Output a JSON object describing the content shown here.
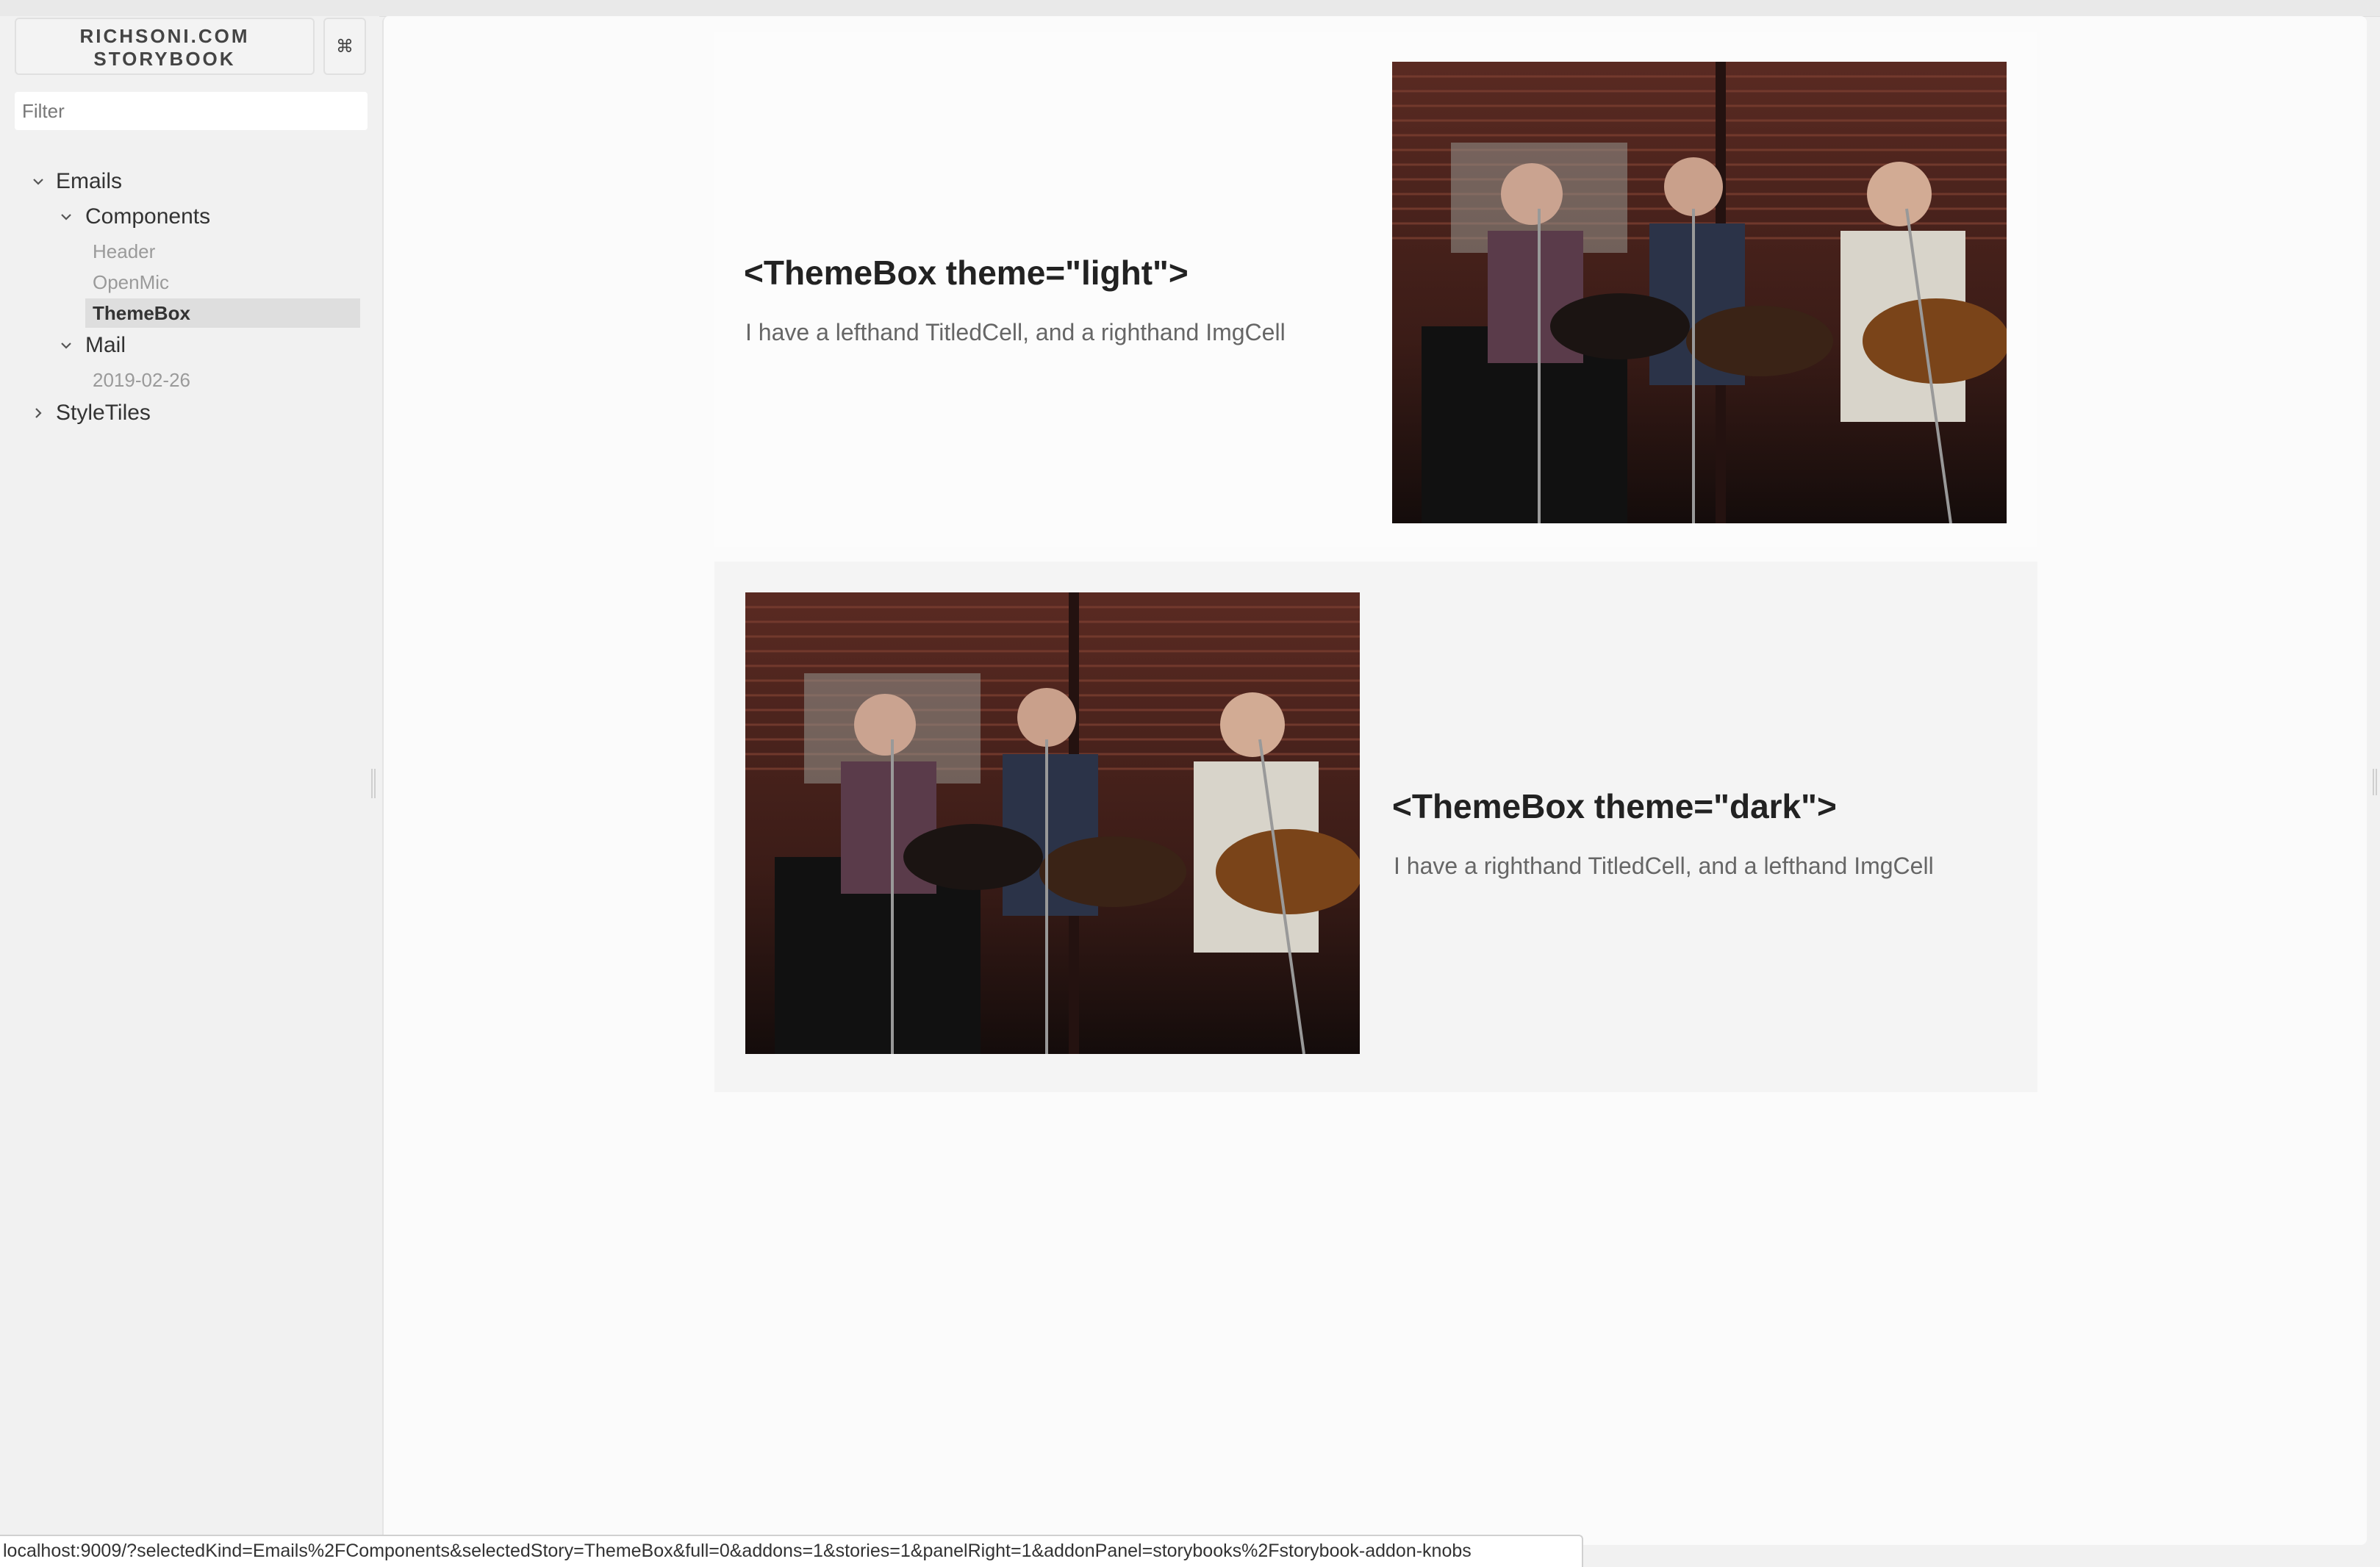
{
  "sidebar": {
    "brand_line1": "RICHSONI.COM",
    "brand_line2": "STORYBOOK",
    "shortcut_symbol": "⌘",
    "filter_placeholder": "Filter",
    "tree": {
      "emails": "Emails",
      "components": "Components",
      "stories_components": [
        "Header",
        "OpenMic",
        "ThemeBox"
      ],
      "selected_story": "ThemeBox",
      "mail": "Mail",
      "stories_mail": [
        "2019-02-26"
      ],
      "styletiles": "StyleTiles"
    }
  },
  "preview": {
    "light": {
      "title": "<ThemeBox theme=\"light\">",
      "description": "I have a lefthand TitledCell, and a righthand ImgCell",
      "background": "#fcfcfc"
    },
    "dark": {
      "title": "<ThemeBox theme=\"dark\">",
      "description": "I have a righthand TitledCell, and a lefthand ImgCell",
      "background": "#f4f4f4"
    }
  },
  "statusbar": {
    "url": "localhost:9009/?selectedKind=Emails%2FComponents&selectedStory=ThemeBox&full=0&addons=1&stories=1&panelRight=1&addonPanel=storybooks%2Fstorybook-addon-knobs"
  },
  "icons": {
    "expanded": "chevron-down-icon",
    "collapsed": "chevron-right-icon",
    "shortcut": "command-icon"
  }
}
